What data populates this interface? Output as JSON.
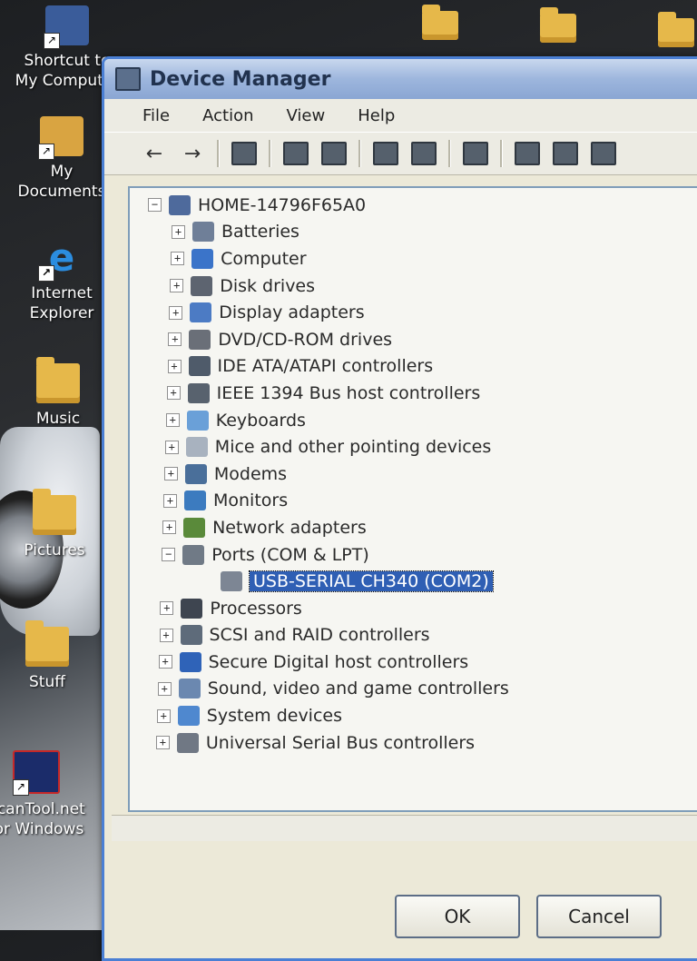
{
  "desktop": {
    "icons": [
      {
        "label": "Shortcut to My Computer"
      },
      {
        "label": "My Documents"
      },
      {
        "label": "Internet Explorer"
      },
      {
        "label": "Music"
      },
      {
        "label": "Pictures"
      },
      {
        "label": "Stuff"
      },
      {
        "label": "ScanTool.net for Windows"
      }
    ]
  },
  "window": {
    "title": "Device Manager",
    "menu": [
      "File",
      "Action",
      "View",
      "Help"
    ],
    "buttons": {
      "ok": "OK",
      "cancel": "Cancel"
    }
  },
  "tree": {
    "root": "HOME-14796F65A0",
    "items": [
      {
        "label": "Batteries",
        "expander": "+",
        "icon": "battery-icon"
      },
      {
        "label": "Computer",
        "expander": "+",
        "icon": "computer-icon"
      },
      {
        "label": "Disk drives",
        "expander": "+",
        "icon": "disk-drive-icon"
      },
      {
        "label": "Display adapters",
        "expander": "+",
        "icon": "display-adapter-icon"
      },
      {
        "label": "DVD/CD-ROM drives",
        "expander": "+",
        "icon": "dvd-drive-icon"
      },
      {
        "label": "IDE ATA/ATAPI controllers",
        "expander": "+",
        "icon": "ide-controller-icon"
      },
      {
        "label": "IEEE 1394 Bus host controllers",
        "expander": "+",
        "icon": "ieee1394-icon"
      },
      {
        "label": "Keyboards",
        "expander": "+",
        "icon": "keyboard-icon"
      },
      {
        "label": "Mice and other pointing devices",
        "expander": "+",
        "icon": "mouse-icon"
      },
      {
        "label": "Modems",
        "expander": "+",
        "icon": "modem-icon"
      },
      {
        "label": "Monitors",
        "expander": "+",
        "icon": "monitor-icon"
      },
      {
        "label": "Network adapters",
        "expander": "+",
        "icon": "network-adapter-icon"
      },
      {
        "label": "Ports (COM & LPT)",
        "expander": "−",
        "icon": "port-icon"
      },
      {
        "label": "USB-SERIAL CH340 (COM2)",
        "child": true,
        "selected": true,
        "icon": "serial-port-icon"
      },
      {
        "label": "Processors",
        "expander": "+",
        "icon": "processor-icon"
      },
      {
        "label": "SCSI and RAID controllers",
        "expander": "+",
        "icon": "scsi-icon"
      },
      {
        "label": "Secure Digital host controllers",
        "expander": "+",
        "icon": "sd-card-icon"
      },
      {
        "label": "Sound, video and game controllers",
        "expander": "+",
        "icon": "sound-icon"
      },
      {
        "label": "System devices",
        "expander": "+",
        "icon": "system-device-icon"
      },
      {
        "label": "Universal Serial Bus controllers",
        "expander": "+",
        "icon": "usb-icon"
      }
    ]
  },
  "colors": {
    "title_bar": "#9db6dd",
    "window_border": "#4a7fd4",
    "selection": "#2f5fb4",
    "pane_background": "#f6f6f2"
  }
}
